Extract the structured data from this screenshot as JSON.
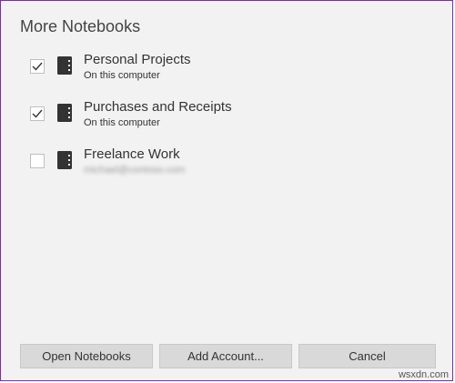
{
  "dialog": {
    "title": "More Notebooks"
  },
  "notebooks": [
    {
      "name": "Personal Projects",
      "location": "On this computer",
      "checked": true
    },
    {
      "name": "Purchases and Receipts",
      "location": "On this computer",
      "checked": true
    },
    {
      "name": "Freelance Work",
      "location": "michael@contoso.com",
      "checked": false
    }
  ],
  "buttons": {
    "open_label": "Open Notebooks",
    "add_account_label": "Add Account...",
    "cancel_label": "Cancel"
  },
  "icons": {
    "notebook": "notebook-icon",
    "checkmark": "checkmark-icon"
  },
  "watermark": "wsxdn.com",
  "colors": {
    "dialog_background": "#f2f2f2",
    "border_accent": "#6b3a8f",
    "button_background": "#d9d9d9",
    "icon_color": "#333333"
  }
}
